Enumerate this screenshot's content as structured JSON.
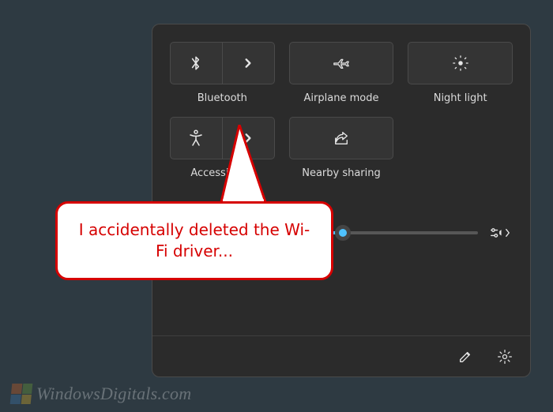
{
  "panel": {
    "tiles": [
      {
        "id": "bluetooth",
        "label": "Bluetooth",
        "icon": "bluetooth-icon",
        "split": true
      },
      {
        "id": "airplane",
        "label": "Airplane mode",
        "icon": "airplane-icon",
        "split": false
      },
      {
        "id": "nightlight",
        "label": "Night light",
        "icon": "night-light-icon",
        "split": false
      },
      {
        "id": "accessibility",
        "label": "Accessibility",
        "icon": "accessibility-icon",
        "split": true
      },
      {
        "id": "nearby",
        "label": "Nearby sharing",
        "icon": "share-icon",
        "split": false
      }
    ],
    "slider": {
      "value_percent": 56,
      "end_icon": "volume-expand-icon"
    },
    "footer": {
      "edit_icon": "pencil-icon",
      "settings_icon": "gear-icon"
    }
  },
  "callout": {
    "text": "I accidentally deleted the Wi-Fi driver..."
  },
  "watermark": {
    "text": "WindowsDigitals.com"
  },
  "colors": {
    "panel_bg": "#2b2b2b",
    "tile_bg": "#343434",
    "tile_border": "#4a4a4a",
    "accent": "#4fc2ff",
    "callout_border": "#d60000"
  }
}
